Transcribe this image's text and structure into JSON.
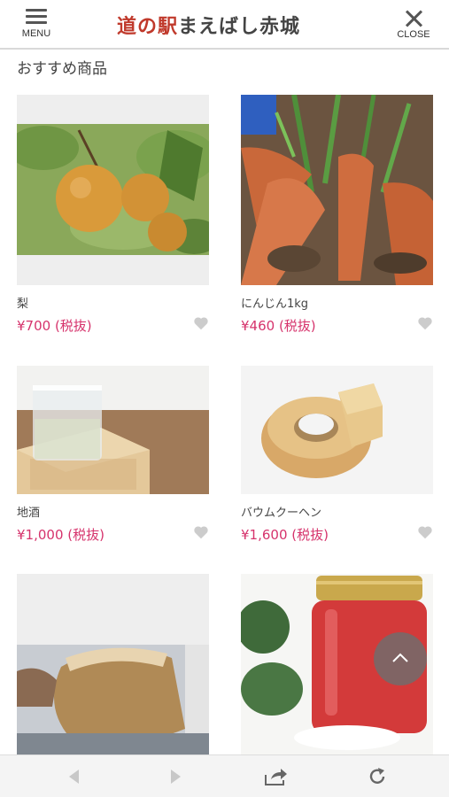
{
  "header": {
    "menu_label": "MENU",
    "close_label": "CLOSE",
    "logo_part1": "道の駅",
    "logo_part2": "まえばし赤城"
  },
  "main": {
    "section_title": "おすすめ商品",
    "products": [
      {
        "name": "梨",
        "price": "¥700 (税抜)"
      },
      {
        "name": "にんじん1kg",
        "price": "¥460 (税抜)"
      },
      {
        "name": "地酒",
        "price": "¥1,000 (税抜)"
      },
      {
        "name": "バウムクーヘン",
        "price": "¥1,600 (税抜)"
      },
      {
        "name": "",
        "price": ""
      },
      {
        "name": "",
        "price": ""
      }
    ]
  },
  "icons": {
    "menu": "hamburger-icon",
    "close": "close-icon",
    "favorite": "heart-icon",
    "scroll_top": "chevron-up-icon",
    "back": "back-arrow-icon",
    "forward": "forward-arrow-icon",
    "share": "share-icon",
    "reload": "reload-icon"
  },
  "colors": {
    "price": "#d6336c",
    "logo_accent": "#c0392b",
    "heart": "#cccccc"
  }
}
